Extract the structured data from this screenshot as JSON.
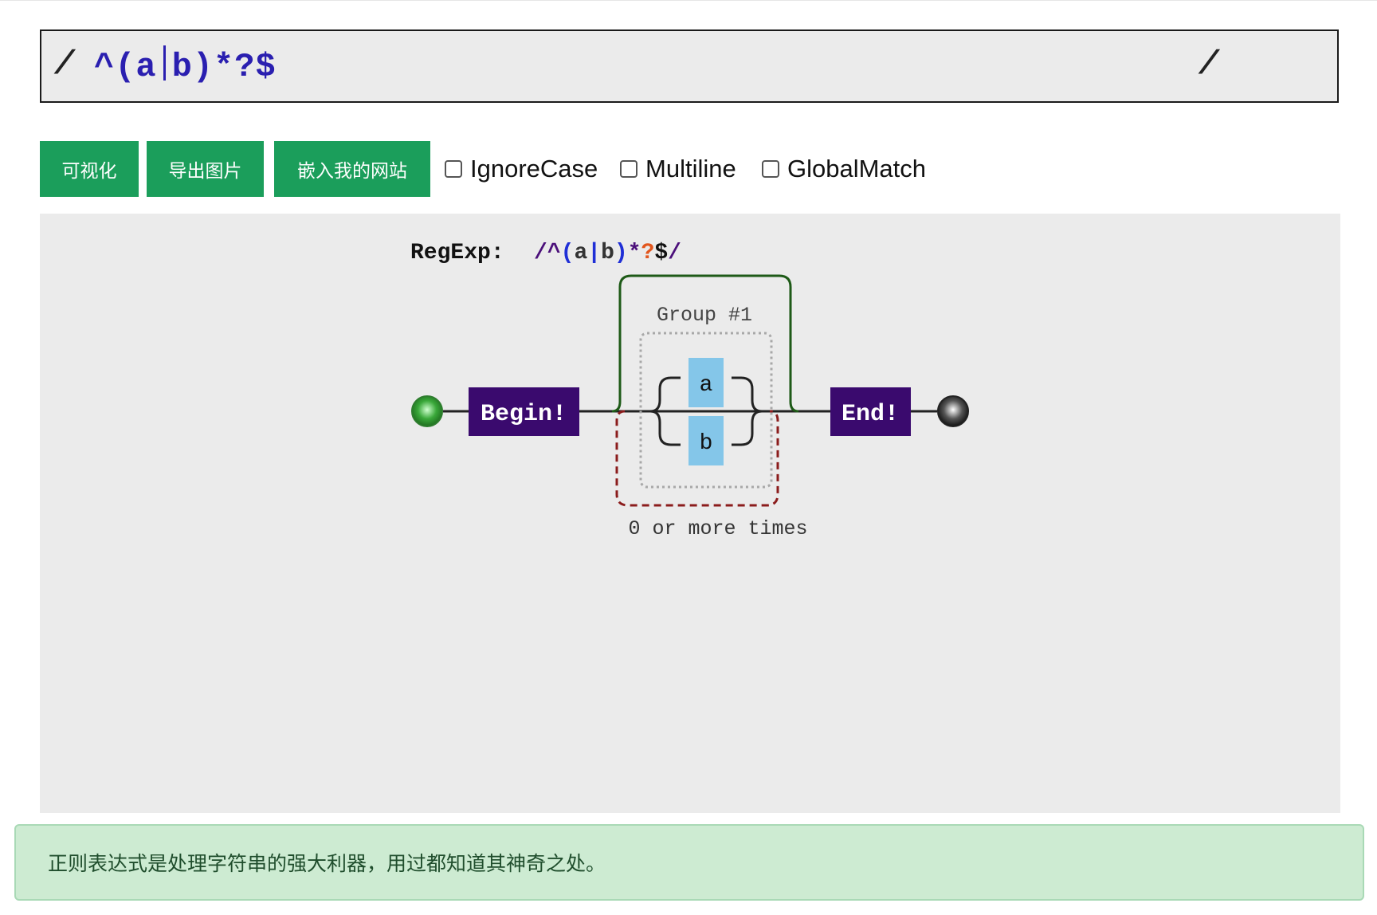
{
  "regex": {
    "left_slash": "/",
    "right_slash": "/",
    "pattern": "^(a|b)*?$",
    "pattern_parts": [
      "^(a",
      "b)*?$"
    ]
  },
  "toolbar": {
    "visualize_label": "可视化",
    "export_label": "导出图片",
    "embed_label": "嵌入我的网站",
    "options": [
      {
        "label": "IgnoreCase",
        "checked": false
      },
      {
        "label": "Multiline",
        "checked": false
      },
      {
        "label": "GlobalMatch",
        "checked": false
      }
    ]
  },
  "diagram": {
    "title_prefix": "RegExp:",
    "title_tokens": [
      {
        "text": "/",
        "color": "#4b0f7a"
      },
      {
        "text": "^",
        "color": "#4b0f7a"
      },
      {
        "text": "(",
        "color": "#1f2fd6"
      },
      {
        "text": "a",
        "color": "#333333"
      },
      {
        "text": "|",
        "color": "#1f2fd6"
      },
      {
        "text": "b",
        "color": "#333333"
      },
      {
        "text": ")",
        "color": "#1f2fd6"
      },
      {
        "text": "*",
        "color": "#4b0f7a"
      },
      {
        "text": "?",
        "color": "#e2561d"
      },
      {
        "text": "$",
        "color": "#111111"
      },
      {
        "text": "/",
        "color": "#4b0f7a"
      }
    ],
    "begin_label": "Begin!",
    "end_label": "End!",
    "group_label": "Group #1",
    "alternatives": [
      "a",
      "b"
    ],
    "repeat_label": "0 or more times",
    "colors": {
      "anchor": "#3a0a6e",
      "char": "#84c6e9",
      "group_border": "#1e5a17",
      "repeat_border": "#8b1c1c"
    }
  },
  "message": {
    "text": "正则表达式是处理字符串的强大利器，用过都知道其神奇之处。"
  }
}
